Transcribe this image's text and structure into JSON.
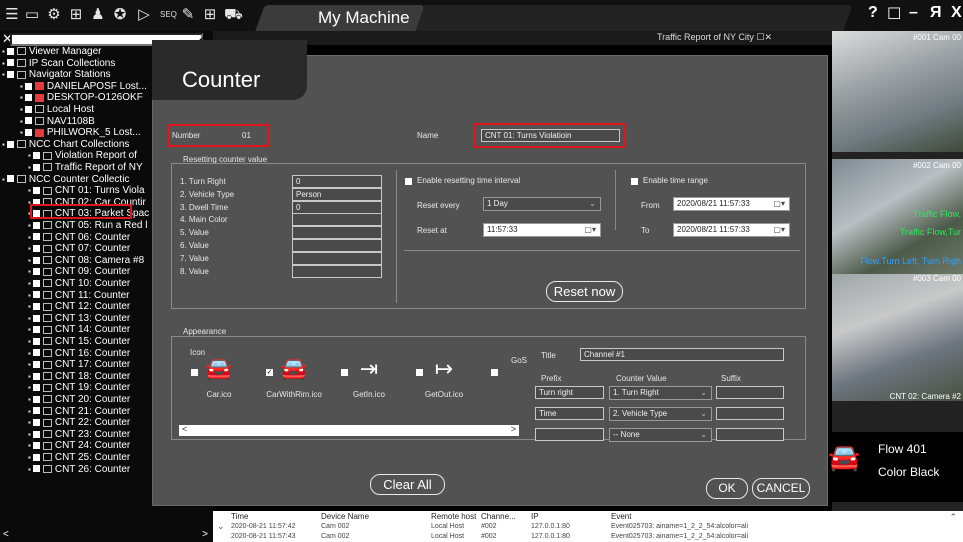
{
  "topbar": {
    "icons": [
      "menu-icon",
      "monitor-icon",
      "settings-icon",
      "screen-add-icon",
      "user-icon",
      "sync-icon",
      "play-icon"
    ],
    "seq_label": "SEQ",
    "title": "My Machine",
    "window_buttons": [
      "?",
      "☐",
      "–",
      "Я",
      "X"
    ]
  },
  "tree": {
    "search_placeholder": "",
    "items": [
      {
        "label": "Viewer Manager",
        "indent": 10,
        "type": "star"
      },
      {
        "label": "IP Scan Collections",
        "indent": 10,
        "type": "scan"
      },
      {
        "label": "Navigator Stations",
        "indent": 10,
        "type": "station"
      },
      {
        "label": "DANIELAPOSF Lost...",
        "indent": 28,
        "type": "red"
      },
      {
        "label": "DESKTOP-O126OKF",
        "indent": 28,
        "type": "red"
      },
      {
        "label": "Local Host",
        "indent": 28,
        "type": "station"
      },
      {
        "label": "NAV1108B",
        "indent": 28,
        "type": "station"
      },
      {
        "label": "PHILWORK_5 Lost...",
        "indent": 28,
        "type": "red"
      },
      {
        "label": "NCC Chart Collections",
        "indent": 10,
        "type": "chart"
      },
      {
        "label": "Violation Report of",
        "indent": 36,
        "type": "chart"
      },
      {
        "label": "Traffic Report of NY",
        "indent": 36,
        "type": "chart"
      },
      {
        "label": "NCC Counter Collectic",
        "indent": 10,
        "type": "counter"
      },
      {
        "label": "CNT 01: Turns Viola",
        "indent": 36,
        "type": "counter"
      },
      {
        "label": "CNT 02: Car Countir",
        "indent": 36,
        "type": "counter"
      },
      {
        "label": "CNT 03: Parket Spac",
        "indent": 36,
        "type": "counter"
      },
      {
        "label": "CNT 05: Run a Red l",
        "indent": 36,
        "type": "counter"
      },
      {
        "label": "CNT 06: Counter",
        "indent": 36,
        "type": "counter"
      },
      {
        "label": "CNT 07: Counter",
        "indent": 36,
        "type": "counter"
      },
      {
        "label": "CNT 08: Camera #8",
        "indent": 36,
        "type": "counter"
      },
      {
        "label": "CNT 09: Counter",
        "indent": 36,
        "type": "counter"
      },
      {
        "label": "CNT 10: Counter",
        "indent": 36,
        "type": "counter"
      },
      {
        "label": "CNT 11: Counter",
        "indent": 36,
        "type": "counter"
      },
      {
        "label": "CNT 12: Counter",
        "indent": 36,
        "type": "counter"
      },
      {
        "label": "CNT 13: Counter",
        "indent": 36,
        "type": "counter"
      },
      {
        "label": "CNT 14: Counter",
        "indent": 36,
        "type": "counter"
      },
      {
        "label": "CNT 15: Counter",
        "indent": 36,
        "type": "counter"
      },
      {
        "label": "CNT 16: Counter",
        "indent": 36,
        "type": "counter"
      },
      {
        "label": "CNT 17: Counter",
        "indent": 36,
        "type": "counter"
      },
      {
        "label": "CNT 18: Counter",
        "indent": 36,
        "type": "counter"
      },
      {
        "label": "CNT 19: Counter",
        "indent": 36,
        "type": "counter"
      },
      {
        "label": "CNT 20: Counter",
        "indent": 36,
        "type": "counter"
      },
      {
        "label": "CNT 21: Counter",
        "indent": 36,
        "type": "counter"
      },
      {
        "label": "CNT 22: Counter",
        "indent": 36,
        "type": "counter"
      },
      {
        "label": "CNT 23: Counter",
        "indent": 36,
        "type": "counter"
      },
      {
        "label": "CNT 24: Counter",
        "indent": 36,
        "type": "counter"
      },
      {
        "label": "CNT 25: Counter",
        "indent": 36,
        "type": "counter"
      },
      {
        "label": "CNT 26: Counter",
        "indent": 36,
        "type": "counter"
      }
    ]
  },
  "report_panel": {
    "title": "Traffic Report of NY City"
  },
  "cameras": {
    "cam1": "#001 Cam 00",
    "cam2": "#002 Cam 00",
    "cam2_overlay_1": "Traffic Flow,",
    "cam2_overlay_2": "Traffic Flow,Tur",
    "cam2_overlay_3": "Flow,Turn Left, Turn Righ",
    "cam3": "#003 Cam 00",
    "cam3_caption": "CNT 02: Camera #2",
    "info_flow": "Flow 401",
    "info_color": "Color Black"
  },
  "dialog": {
    "title": "Counter",
    "number_label": "Number",
    "number_value": "01",
    "name_label": "Name",
    "name_value": "CNT 01: Turns Violatioin",
    "resetting_title": "Resetting counter value",
    "rows": [
      {
        "label": "1. Turn Right",
        "value": "0"
      },
      {
        "label": "2. Vehicle Type",
        "value": "Person"
      },
      {
        "label": "3. Dwell Time",
        "value": "0"
      },
      {
        "label": "4. Main Color",
        "value": ""
      },
      {
        "label": "5. Value",
        "value": ""
      },
      {
        "label": "6. Value",
        "value": ""
      },
      {
        "label": "7. Value",
        "value": ""
      },
      {
        "label": "8. Value",
        "value": ""
      }
    ],
    "enable_interval_label": "Enable resetting time interval",
    "reset_every_label": "Reset every",
    "reset_every_value": "1 Day",
    "reset_at_label": "Reset at",
    "reset_at_value": "11:57:33",
    "enable_range_label": "Enable time range",
    "from_label": "From",
    "from_value": "2020/08/21 11:57:33",
    "to_label": "To",
    "to_value": "2020/08/21 11:57:33",
    "reset_now_label": "Reset now",
    "appearance_title": "Appearance",
    "icon_label": "Icon",
    "icons": [
      {
        "name": "Car.ico",
        "glyph": "🚘",
        "checked": false
      },
      {
        "name": "CarWithRim.ico",
        "glyph": "🚘",
        "checked": true
      },
      {
        "name": "GetIn.ico",
        "glyph": "⇥",
        "checked": false
      },
      {
        "name": "GetOut.ico",
        "glyph": "↦",
        "checked": false
      },
      {
        "name": "GoS",
        "glyph": "",
        "checked": false
      }
    ],
    "title_label": "Title",
    "title_value": "Channel #1",
    "prefix_header": "Prefix",
    "counter_value_header": "Counter Value",
    "suffix_header": "Suffix",
    "prefix_rows": [
      "Turn right",
      "Time",
      ""
    ],
    "counter_value_rows": [
      "1. Turn Right",
      "2. Vehicle Type",
      "-- None"
    ],
    "suffix_rows": [
      "",
      "",
      ""
    ],
    "clear_all_label": "Clear All",
    "ok_label": "OK",
    "cancel_label": "CANCEL"
  },
  "log": {
    "headers": [
      "Time",
      "Device Name",
      "Remote host",
      "Channe...",
      "IP",
      "Event"
    ],
    "rows": [
      [
        "2020-08-21 11:57:42",
        "Cam 002",
        "Local Host",
        "#002",
        "127.0.0.1:80",
        "Event025703: ainame=1_2_2_54:alcolor=ali"
      ],
      [
        "2020-08-21 11:57:43",
        "Cam 002",
        "Local Host",
        "#002",
        "127.0.0.1:80",
        "Event025703: ainame=1_2_2_54:alcolor=ali"
      ]
    ]
  },
  "colors": {
    "highlight_red": "#e0161c",
    "dialog_bg": "#525252"
  }
}
